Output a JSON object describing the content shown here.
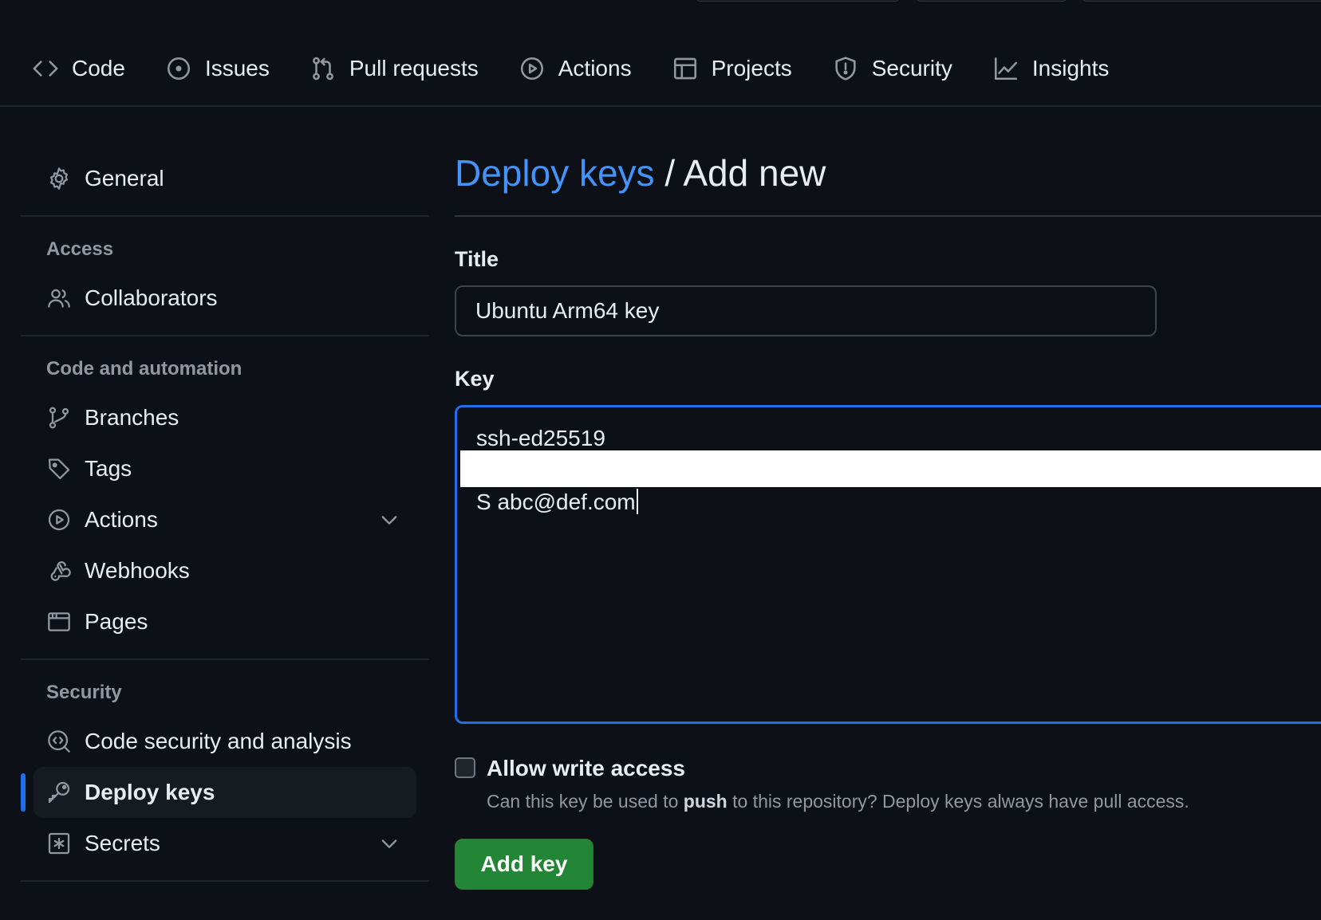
{
  "topnav": {
    "tabs": [
      {
        "label": "Code",
        "icon": "code-icon"
      },
      {
        "label": "Issues",
        "icon": "issue-icon"
      },
      {
        "label": "Pull requests",
        "icon": "pull-request-icon"
      },
      {
        "label": "Actions",
        "icon": "play-icon"
      },
      {
        "label": "Projects",
        "icon": "table-icon"
      },
      {
        "label": "Security",
        "icon": "shield-icon"
      },
      {
        "label": "Insights",
        "icon": "graph-icon"
      }
    ]
  },
  "sidebar": {
    "general": {
      "label": "General",
      "icon": "gear-icon"
    },
    "sections": [
      {
        "title": "Access",
        "items": [
          {
            "label": "Collaborators",
            "icon": "people-icon"
          }
        ]
      },
      {
        "title": "Code and automation",
        "items": [
          {
            "label": "Branches",
            "icon": "branch-icon"
          },
          {
            "label": "Tags",
            "icon": "tag-icon"
          },
          {
            "label": "Actions",
            "icon": "play-icon",
            "expandable": true
          },
          {
            "label": "Webhooks",
            "icon": "webhook-icon"
          },
          {
            "label": "Pages",
            "icon": "browser-icon"
          }
        ]
      },
      {
        "title": "Security",
        "items": [
          {
            "label": "Code security and analysis",
            "icon": "codescan-icon"
          },
          {
            "label": "Deploy keys",
            "icon": "key-icon",
            "active": true
          },
          {
            "label": "Secrets",
            "icon": "asterisk-icon",
            "expandable": true
          }
        ]
      }
    ]
  },
  "main": {
    "breadcrumb": {
      "link": "Deploy keys",
      "separator": " / ",
      "current": "Add new"
    },
    "title_field": {
      "label": "Title",
      "value": "Ubuntu Arm64 key"
    },
    "key_field": {
      "label": "Key",
      "line1": "ssh-ed25519",
      "line3": "S abc@def.com"
    },
    "write_access": {
      "label": "Allow write access",
      "checked": false,
      "help_before": "Can this key be used to ",
      "help_bold": "push",
      "help_after": " to this repository? Deploy keys always have pull access."
    },
    "submit_label": "Add key"
  },
  "colors": {
    "background": "#0d1117",
    "link": "#4493f8",
    "focus_border": "#1f6feb",
    "button": "#238636",
    "muted_text": "#9198a1"
  }
}
